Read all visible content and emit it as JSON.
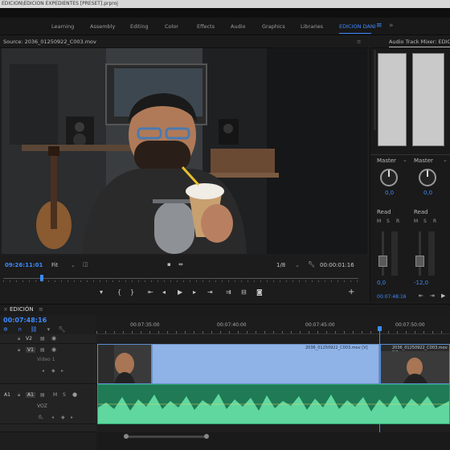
{
  "window": {
    "title": "EDICION\\EDICION EXPEDIENTES [PRESET].prproj"
  },
  "workspaces": {
    "tabs": [
      {
        "label": "Learning"
      },
      {
        "label": "Assembly"
      },
      {
        "label": "Editing"
      },
      {
        "label": "Color"
      },
      {
        "label": "Effects"
      },
      {
        "label": "Audio"
      },
      {
        "label": "Graphics"
      },
      {
        "label": "Libraries"
      },
      {
        "label": "EDICION DANI"
      }
    ],
    "menu_icon": "hamburger-icon"
  },
  "source_monitor": {
    "title": "Source: 2036_01250922_C003.mov",
    "timecode": "09:26:11:01",
    "zoom": "Fit",
    "resolution": "1/8",
    "duration": "00:00:01:16"
  },
  "audio_mixer": {
    "title": "Audio Track Mixer: EDICIÓN",
    "channels": [
      {
        "name": "Master",
        "mode": "Read",
        "pan": "0,0",
        "db": "0,0"
      },
      {
        "name": "Master",
        "mode": "Read",
        "pan": "0,0",
        "db": "-12,0"
      }
    ],
    "letters": [
      "M",
      "S",
      "R"
    ],
    "time": "00:07:48:16"
  },
  "timeline": {
    "sequence_name": "EDICIÓN",
    "timecode": "00:07:48:16",
    "ruler_labels": [
      "00:07:35:00",
      "00:07:40:00",
      "00:07:45:00",
      "00:07:50:00"
    ],
    "tracks": {
      "v2": "V2",
      "v1": "V1",
      "v1_name": "Video 1",
      "a1": "A1",
      "a1_src": "A1",
      "a1_name": "VOZ"
    },
    "clips": {
      "video_label": "2036_01250922_C003.mov [V]"
    },
    "audio_volume_label": "0,"
  }
}
